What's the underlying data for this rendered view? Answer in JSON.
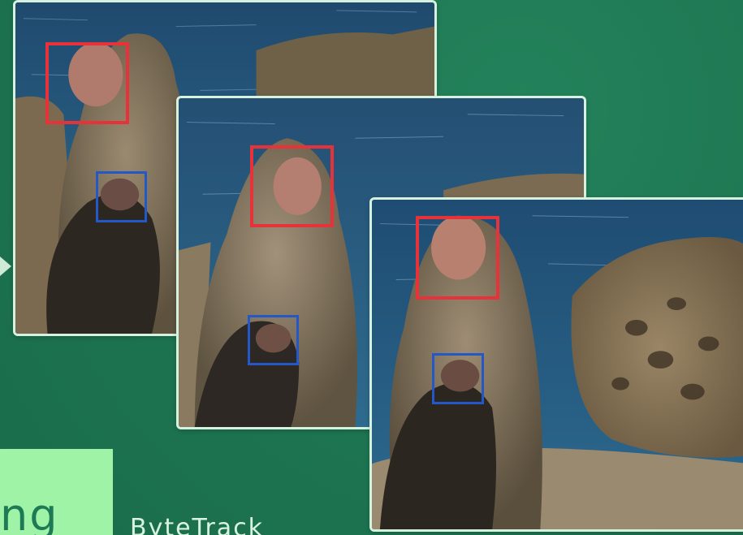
{
  "caption": {
    "partial_text": "ng",
    "brand_text": "ByteTrack"
  },
  "colors": {
    "background": "#1f7a55",
    "frame_border": "#d6f1de",
    "caption_block": "#9ff3a7",
    "adult_box": "#e8323a",
    "infant_box": "#2457c8"
  },
  "frames": [
    {
      "name": "frame-1",
      "boxes": [
        "adult-face",
        "infant-face"
      ]
    },
    {
      "name": "frame-2",
      "boxes": [
        "adult-face",
        "infant-face"
      ]
    },
    {
      "name": "frame-3",
      "boxes": [
        "adult-face",
        "infant-face"
      ]
    }
  ]
}
